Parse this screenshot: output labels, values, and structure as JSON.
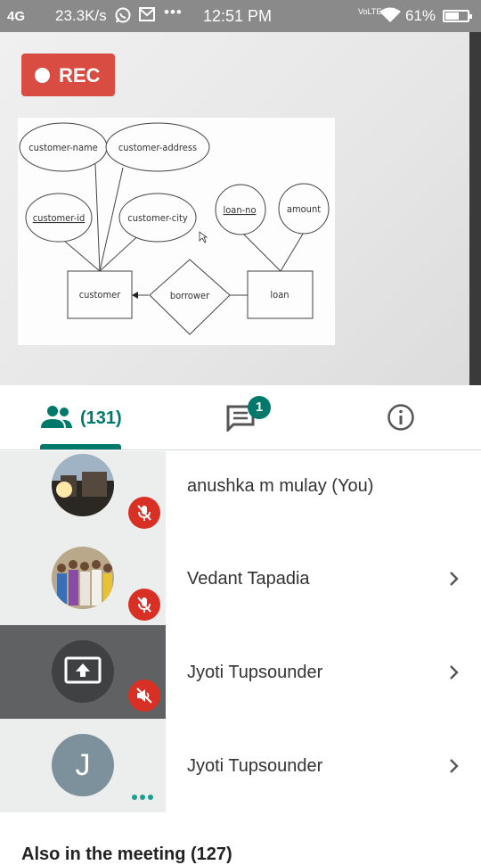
{
  "status_bar": {
    "signal": "4G",
    "speed": "23.3K/s",
    "dots": "•••",
    "time": "12:51 PM",
    "volte": "VoLTE",
    "battery_text": "61%",
    "battery_level": 0.61
  },
  "video": {
    "rec_label": "REC",
    "diagram": {
      "entities": [
        "customer",
        "loan"
      ],
      "relationship": "borrower",
      "attributes": [
        "customer-name",
        "customer-address",
        "customer-id",
        "customer-city",
        "loan-no",
        "amount"
      ]
    }
  },
  "tabs": {
    "people_count": "(131)",
    "chat_badge": "1"
  },
  "participants": [
    {
      "name": "anushka m mulay (You)",
      "mic": "muted"
    },
    {
      "name": "Vedant Tapadia",
      "mic": "muted"
    },
    {
      "name": "Jyoti Tupsounder",
      "mic": "audio-off",
      "presenting": true
    },
    {
      "name": "Jyoti Tupsounder",
      "initial": "J"
    }
  ],
  "also_in_meeting": "Also in the meeting (127)",
  "colors": {
    "accent": "#00796b",
    "rec": "#d94c42",
    "mute": "#d93025"
  }
}
